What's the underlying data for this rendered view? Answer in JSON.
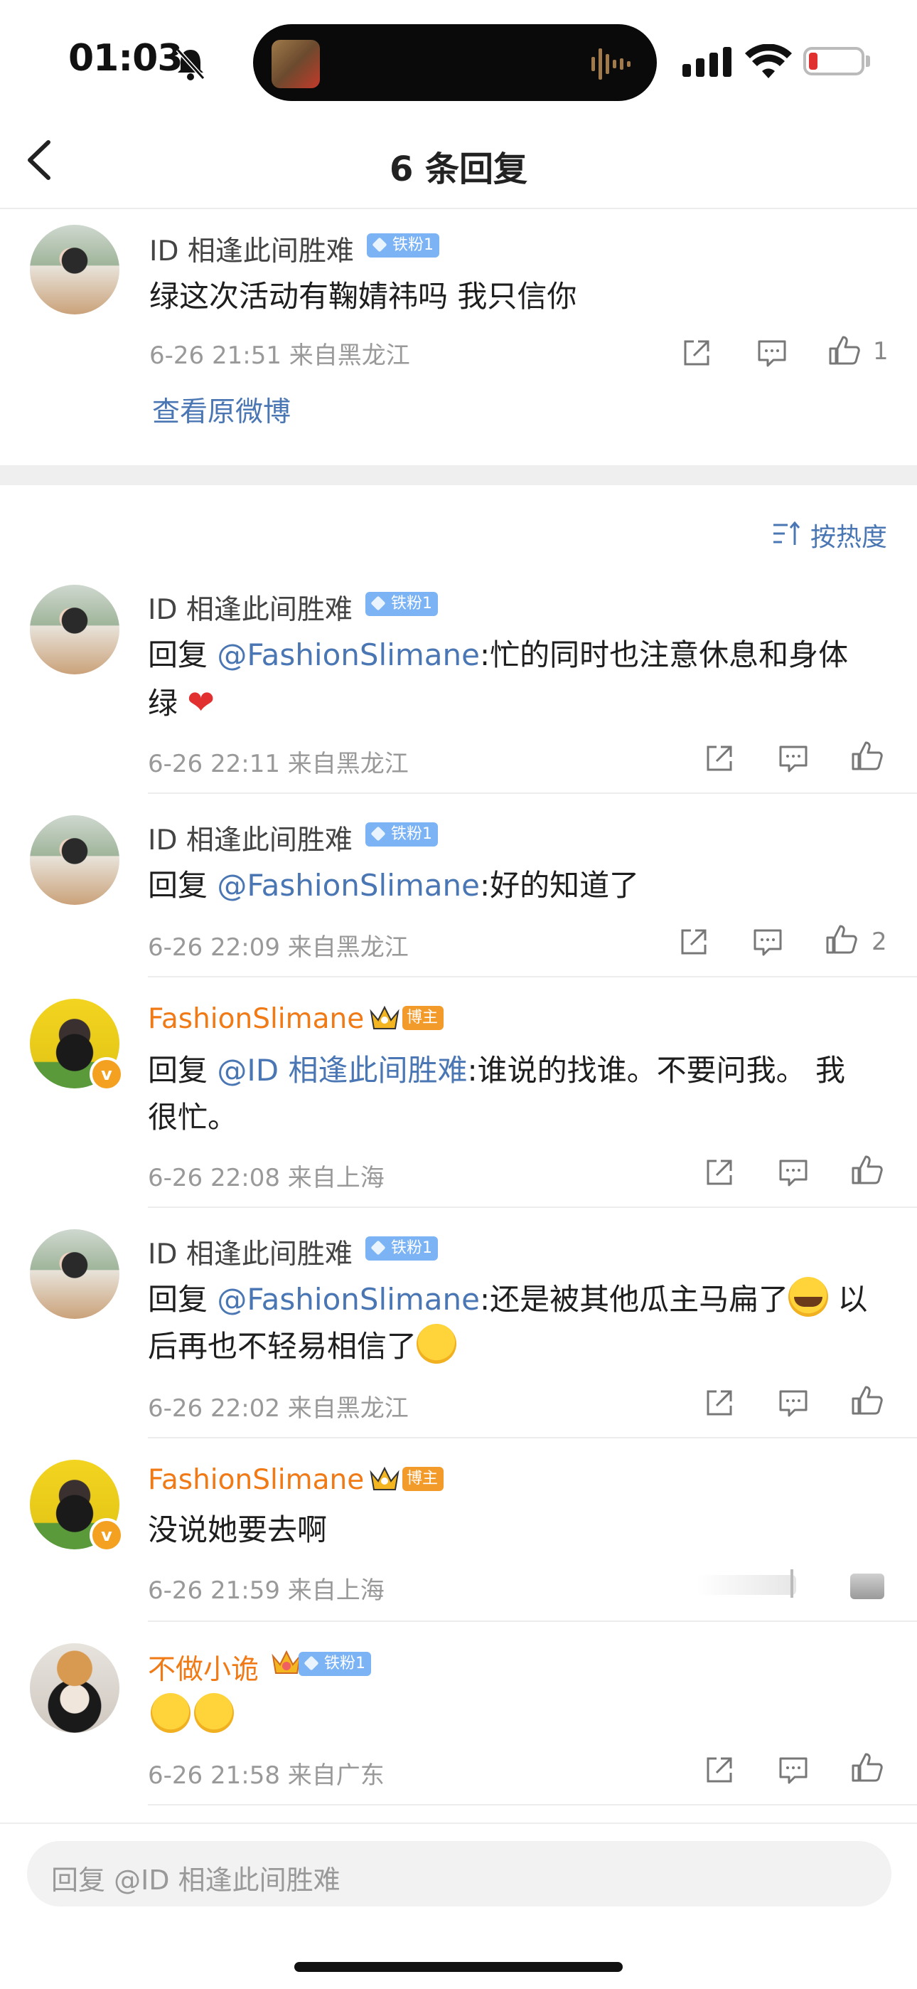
{
  "status": {
    "time": "01:03"
  },
  "nav": {
    "title": "6 条回复"
  },
  "root_comment": {
    "username": "ID 相逢此间胜难",
    "badge": "铁粉1",
    "text": "绿这次活动有鞠婧祎吗 我只信你",
    "meta": "6-26 21:51 来自黑龙江",
    "likes": "1",
    "view_original": "查看原微博"
  },
  "sort_label": "按热度",
  "replies": [
    {
      "username": "ID 相逢此间胜难",
      "badge": "铁粉1",
      "reply_prefix": "回复 ",
      "mention": "@FashionSlimane",
      "text": ":忙的同时也注意休息和身体",
      "text2": "绿",
      "meta": "6-26 22:11 来自黑龙江",
      "likes": ""
    },
    {
      "username": "ID 相逢此间胜难",
      "badge": "铁粉1",
      "reply_prefix": "回复 ",
      "mention": "@FashionSlimane",
      "text": ":好的知道了",
      "meta": "6-26 22:09 来自黑龙江",
      "likes": "2"
    },
    {
      "username": "FashionSlimane",
      "badge": "博主",
      "reply_prefix": "回复 ",
      "mention": "@ID 相逢此间胜难",
      "text": ":谁说的找谁。不要问我。 我",
      "text2": "很忙。",
      "meta": "6-26 22:08 来自上海",
      "likes": ""
    },
    {
      "username": "ID 相逢此间胜难",
      "badge": "铁粉1",
      "reply_prefix": "回复 ",
      "mention": "@FashionSlimane",
      "text": ":还是被其他瓜主马扁了",
      "text_after": " 以",
      "text2": "后再也不轻易相信了",
      "meta": "6-26 22:02 来自黑龙江",
      "likes": ""
    },
    {
      "username": "FashionSlimane",
      "badge": "博主",
      "text": "没说她要去啊",
      "meta": "6-26 21:59 来自上海",
      "likes": ""
    },
    {
      "username": "不做小诡",
      "badge": "铁粉1",
      "meta": "6-26 21:58 来自广东",
      "likes": ""
    }
  ],
  "input": {
    "placeholder": "回复 @ID 相逢此间胜难"
  },
  "icons": {
    "share": "share-icon",
    "comment": "comment-icon",
    "like": "like-icon"
  }
}
